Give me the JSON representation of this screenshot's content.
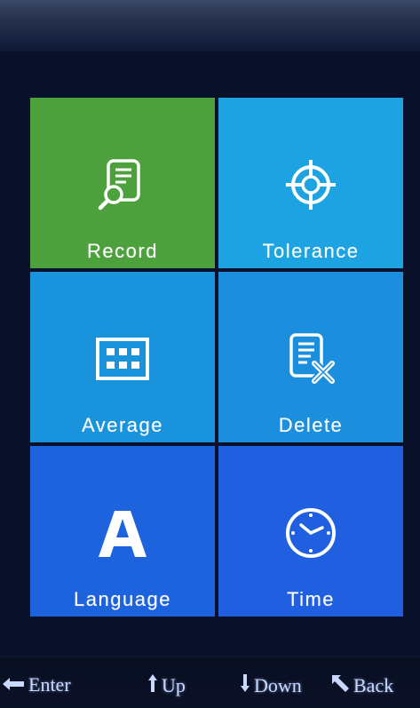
{
  "menu": {
    "items": [
      {
        "label": "Record",
        "icon": "record-search-icon",
        "color": "#4da13d"
      },
      {
        "label": "Tolerance",
        "icon": "crosshair-icon",
        "color": "#1da3e2"
      },
      {
        "label": "Average",
        "icon": "grid-keypad-icon",
        "color": "#1a93dd"
      },
      {
        "label": "Delete",
        "icon": "document-delete-icon",
        "color": "#1b8fdd"
      },
      {
        "label": "Language",
        "icon": "letter-a-icon",
        "color": "#1d63de"
      },
      {
        "label": "Time",
        "icon": "clock-icon",
        "color": "#2060e0"
      }
    ],
    "selected": "Record"
  },
  "hints": {
    "enter": "Enter",
    "up": "Up",
    "down": "Down",
    "back": "Back"
  },
  "icons": {
    "enter": "enter-arrow-icon",
    "up": "up-arrow-icon",
    "down": "down-arrow-icon",
    "back": "back-arrow-icon"
  }
}
